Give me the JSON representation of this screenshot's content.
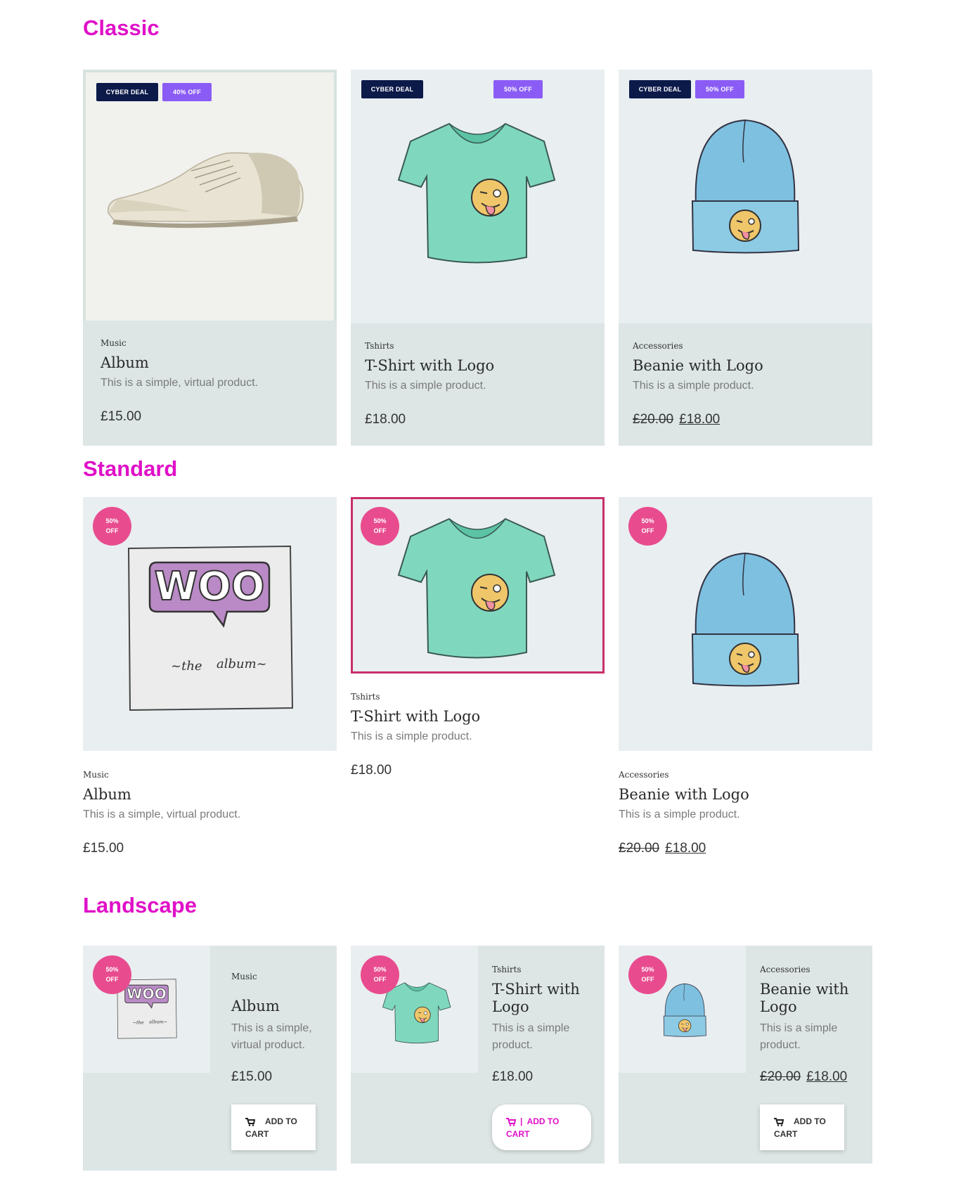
{
  "sections": {
    "classic": "Classic",
    "standard": "Standard",
    "landscape": "Landscape"
  },
  "badges": {
    "cyber_deal": "CYBER DEAL",
    "off_40": "40% OFF",
    "off_50": "50% OFF",
    "circle_pct": "50%",
    "circle_off": "OFF"
  },
  "products": {
    "album": {
      "category": "Music",
      "name": "Album",
      "description": "This is a simple, virtual product.",
      "price": "£15.00"
    },
    "tshirt": {
      "category": "Tshirts",
      "name": "T-Shirt with Logo",
      "description": "This is a simple product.",
      "price": "£18.00"
    },
    "beanie": {
      "category": "Accessories",
      "name": "Beanie with Logo",
      "description": "This is a simple product.",
      "price_old": "£20.00",
      "price_new": "£18.00"
    }
  },
  "landscape": {
    "album": {
      "name": "Album",
      "description_l1": "This is a simple,",
      "description_l2": "virtual product."
    },
    "tshirt": {
      "name_l1": "T-Shirt with",
      "name_l2": "Logo",
      "description_l1": "This is a simple",
      "description_l2": "product."
    },
    "beanie": {
      "name_l1": "Beanie with",
      "name_l2": "Logo",
      "description_l1": "This is a simple",
      "description_l2": "product."
    }
  },
  "buttons": {
    "add_to": "ADD TO",
    "cart": "CART",
    "add_to_pink": "|  ADD TO"
  },
  "colors": {
    "heading": "#e010c8",
    "dark_badge": "#0c1a4a",
    "purple_badge": "#8a5cf5",
    "circle_badge": "#e84c8e",
    "card_bg": "#dde5e5",
    "image_bg": "#e9eef1",
    "highlight_border": "#c8306a"
  }
}
